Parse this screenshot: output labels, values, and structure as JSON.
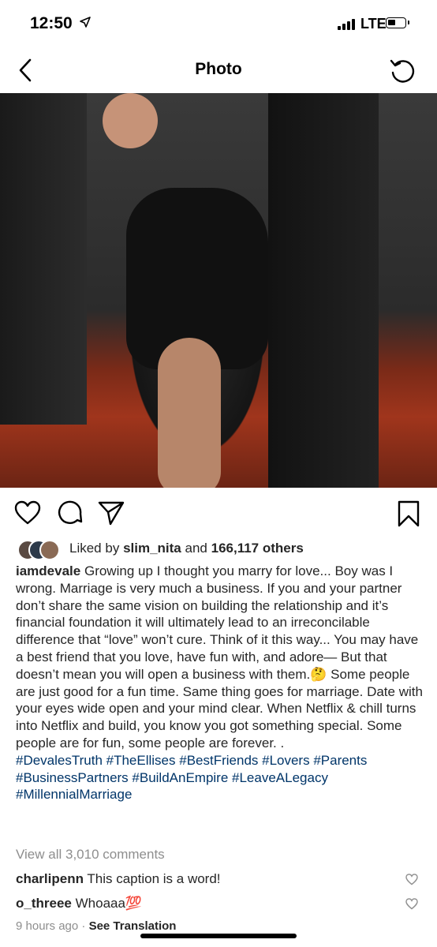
{
  "status_bar": {
    "time": "12:50",
    "network": "LTE"
  },
  "nav": {
    "title": "Photo"
  },
  "likes": {
    "prefix": "Liked by",
    "user": "slim_nita",
    "joiner": "and",
    "count": "166,117 others"
  },
  "post": {
    "username": "iamdevale",
    "caption": "Growing up I thought you marry for love... Boy was I wrong. Marriage is very much a business. If you and your partner don’t share the same vision on building the relationship and it’s financial foundation it will ultimately lead to an irreconcilable difference that “love” won’t cure. Think of it this way... You may have a best friend that you love, have fun with, and adore— But that doesn’t mean you will open a business with them.🤔 Some people are just good for a fun time. Same thing goes for marriage. Date with your eyes wide open and your mind clear. When Netflix & chill turns into Netflix and build, you know you got something special. Some people are for fun, some people are forever. .",
    "hashtags": "#DevalesTruth #TheEllises #BestFriends #Lovers #Parents #BusinessPartners #BuildAnEmpire #LeaveALegacy #MillennialMarriage"
  },
  "comments": {
    "view_all": "View all 3,010 comments",
    "items": [
      {
        "user": "charlipenn",
        "text": "This caption is a word!"
      },
      {
        "user": "o_threee",
        "text": "Whoaaa💯"
      }
    ]
  },
  "meta": {
    "time_ago": "9 hours ago",
    "separator": "·",
    "see_translation": "See Translation"
  },
  "icons": {
    "back": "chevron-left-icon",
    "refresh": "refresh-icon",
    "like": "heart-icon",
    "comment": "comment-icon",
    "share": "send-icon",
    "save": "bookmark-icon"
  },
  "colors": {
    "link": "#003569",
    "muted": "#8e8e8e",
    "text": "#262626"
  }
}
